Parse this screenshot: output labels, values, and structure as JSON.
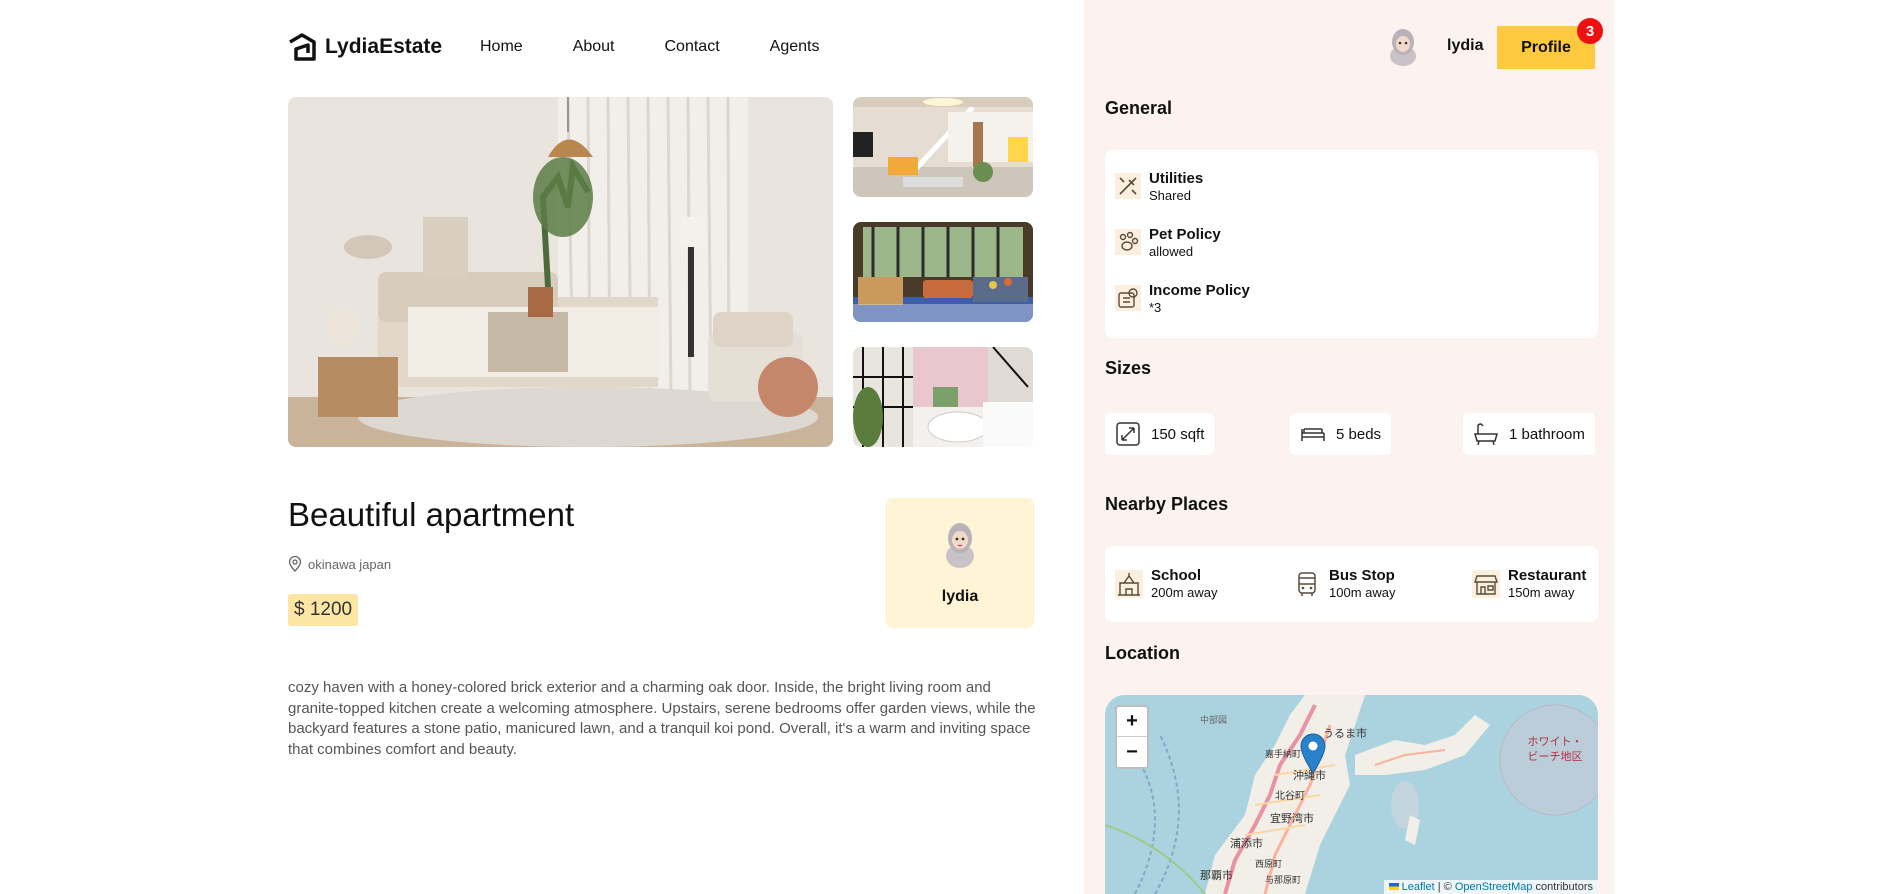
{
  "brand": {
    "name": "LydiaEstate"
  },
  "nav": {
    "items": [
      "Home",
      "About",
      "Contact",
      "Agents"
    ]
  },
  "user": {
    "name": "lydia",
    "profile_label": "Profile",
    "notification_count": "3"
  },
  "listing": {
    "title": "Beautiful apartment",
    "location": "okinawa japan",
    "price": "$ 1200",
    "description": "cozy haven with a honey-colored brick exterior and a charming oak door. Inside, the bright living room and granite-topped kitchen create a welcoming atmosphere. Upstairs, serene bedrooms offer garden views, while the backyard features a stone patio, manicured lawn, and a tranquil koi pond. Overall, it's a warm and inviting space that combines comfort and beauty.",
    "agent_name": "lydia"
  },
  "general": {
    "title": "General",
    "items": [
      {
        "label": "Utilities",
        "value": "Shared",
        "icon": "tools-icon"
      },
      {
        "label": "Pet Policy",
        "value": "allowed",
        "icon": "paw-icon"
      },
      {
        "label": "Income Policy",
        "value": "*3",
        "icon": "money-icon"
      }
    ]
  },
  "sizes": {
    "title": "Sizes",
    "items": [
      {
        "label": "150 sqft",
        "icon": "area-icon"
      },
      {
        "label": "5 beds",
        "icon": "bed-icon"
      },
      {
        "label": "1 bathroom",
        "icon": "bath-icon"
      }
    ]
  },
  "nearby": {
    "title": "Nearby Places",
    "items": [
      {
        "label": "School",
        "value": "200m away",
        "icon": "school-icon"
      },
      {
        "label": "Bus Stop",
        "value": "100m away",
        "icon": "bus-icon"
      },
      {
        "label": "Restaurant",
        "value": "150m away",
        "icon": "restaurant-icon"
      }
    ]
  },
  "location_section": {
    "title": "Location"
  },
  "map": {
    "zoom_in": "+",
    "zoom_out": "−",
    "attribution_leaflet": "Leaflet",
    "attribution_sep": " | © ",
    "attribution_osm": "OpenStreetMap",
    "attribution_tail": " contributors",
    "labels": [
      "うるま市",
      "沖縄市",
      "北谷町",
      "宜野湾市",
      "浦添市",
      "西原町",
      "那覇市",
      "与那原町",
      "嘉手納町",
      "中部図",
      "ホワイト・ビーチ地区"
    ]
  },
  "colors": {
    "accent": "#fcc93f",
    "panel_bg": "#fcf2ef",
    "badge": "#ee1111",
    "agent_card": "#fff5d6",
    "price_bg": "#fde6a3"
  }
}
